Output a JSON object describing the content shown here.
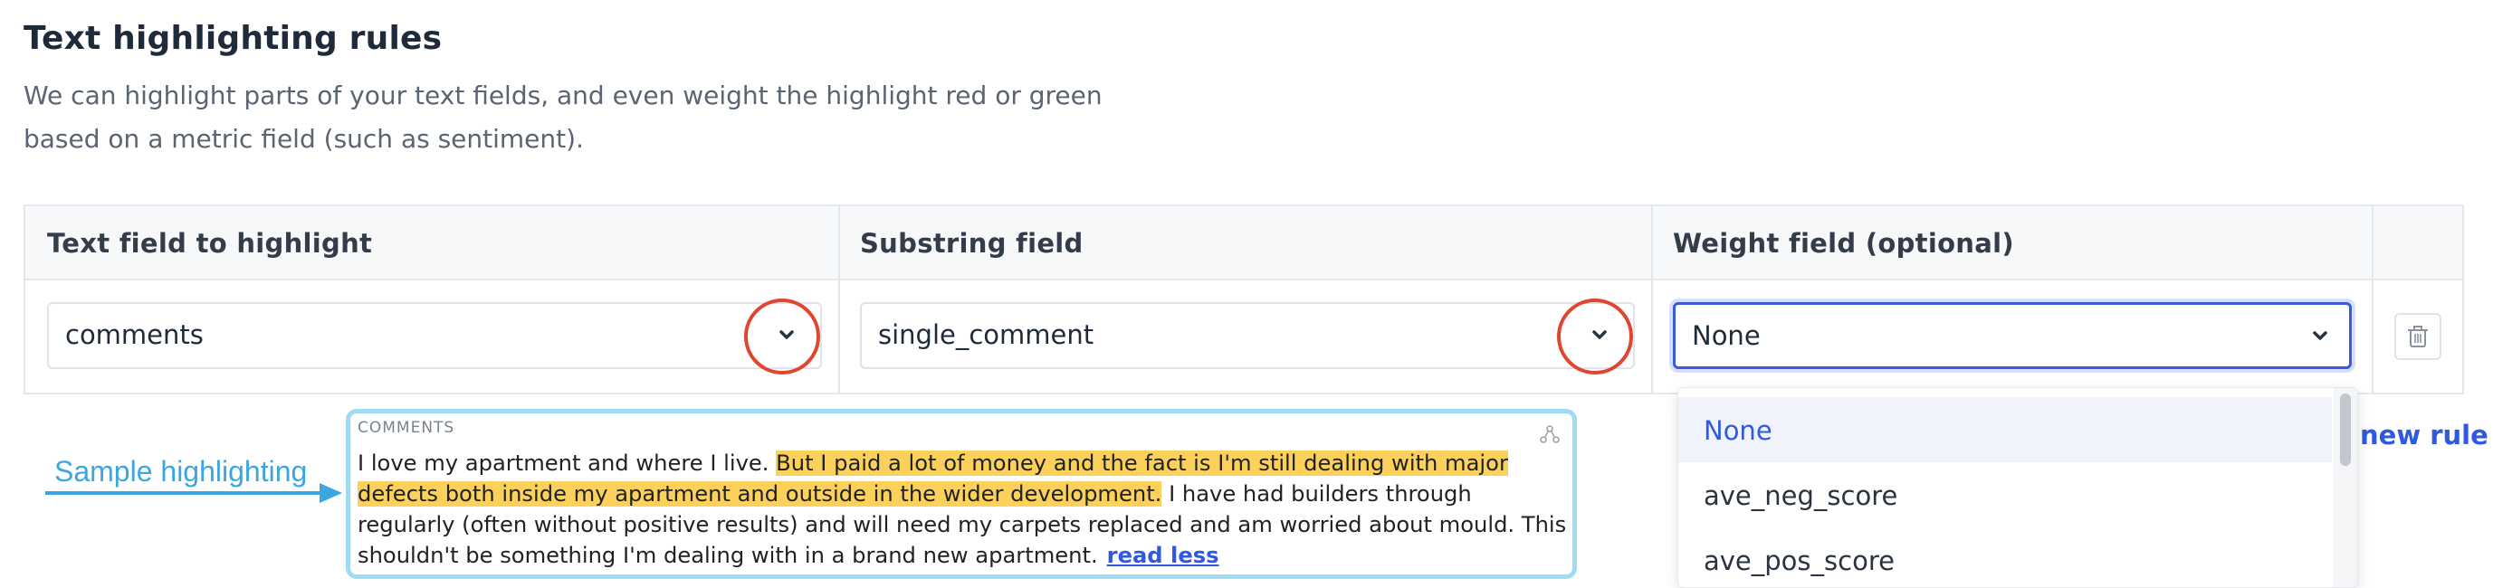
{
  "header": {
    "title": "Text highlighting rules",
    "description_line1": "We can highlight parts of your text fields, and even weight the highlight red or green",
    "description_line2": "based on a metric field (such as sentiment)."
  },
  "table": {
    "columns": [
      "Text field to highlight",
      "Substring field",
      "Weight field (optional)"
    ],
    "row": {
      "text_field": "comments",
      "substring_field": "single_comment",
      "weight_field": "None"
    }
  },
  "weight_dropdown": {
    "options": [
      "None",
      "ave_neg_score",
      "ave_pos_score"
    ],
    "selected": "None"
  },
  "add_rule_label": "new rule",
  "annotation": {
    "sample_label": "Sample highlighting",
    "accent_color": "#3aa7e0",
    "circle_color": "#e0452f"
  },
  "preview": {
    "field_label": "COMMENTS",
    "text_plain_1": "I love my apartment and where I live. ",
    "text_highlight": "But I paid a lot of money and the fact is I'm still dealing with major defects both inside my apartment and outside in the wider development.",
    "text_plain_2": " I have had builders through regularly (often without positive results) and will need my carpets replaced and am worried about mould. This shouldn't be something I'm dealing with in a brand new apartment.",
    "read_less_label": "read less",
    "highlight_color": "#fbd15b"
  }
}
